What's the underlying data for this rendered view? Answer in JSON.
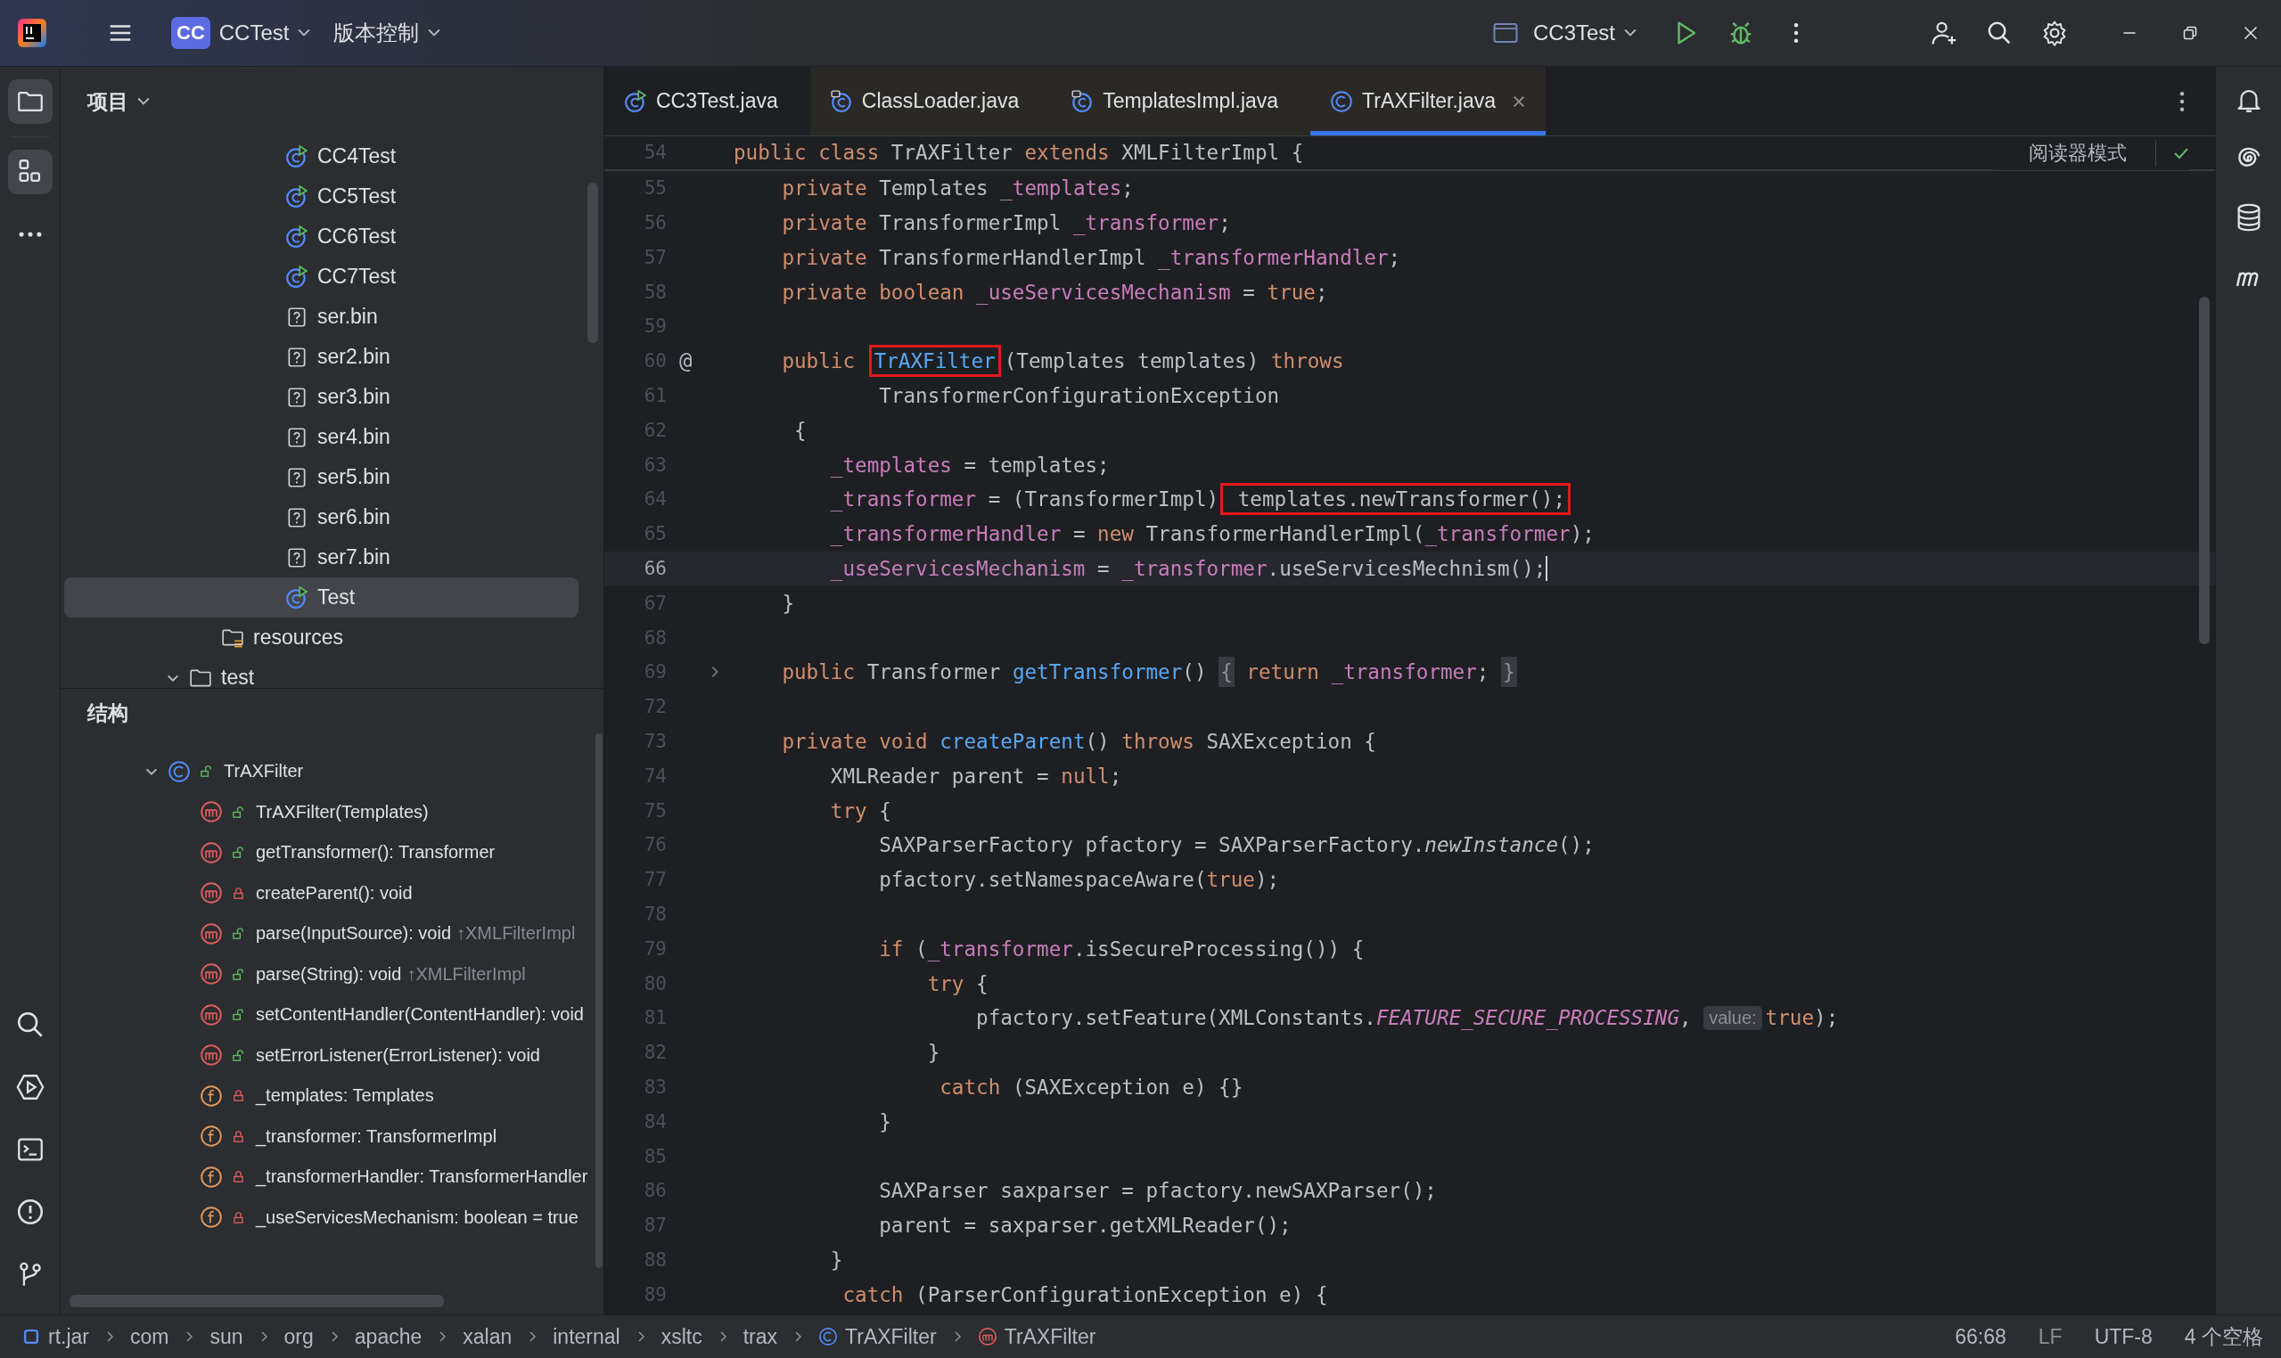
{
  "title_bar": {
    "project_badge": "CC",
    "project_name": "CCTest",
    "vcs": "版本控制",
    "run_config": "CC3Test"
  },
  "project_panel": {
    "title": "项目",
    "tree": [
      {
        "children": [
          {
            "children": [
              {
                "children": [
                  {
                    "label": "CC4Test",
                    "kind": "runnable",
                    "selected": false
                  },
                  {
                    "label": "CC5Test",
                    "kind": "runnable",
                    "selected": false
                  },
                  {
                    "label": "CC6Test",
                    "kind": "runnable",
                    "selected": false
                  },
                  {
                    "label": "CC7Test",
                    "kind": "runnable",
                    "selected": false
                  },
                  {
                    "label": "ser.bin",
                    "kind": "unknown",
                    "selected": false
                  },
                  {
                    "label": "ser2.bin",
                    "kind": "unknown",
                    "selected": false
                  },
                  {
                    "label": "ser3.bin",
                    "kind": "unknown",
                    "selected": false
                  },
                  {
                    "label": "ser4.bin",
                    "kind": "unknown",
                    "selected": false
                  },
                  {
                    "label": "ser5.bin",
                    "kind": "unknown",
                    "selected": false
                  },
                  {
                    "label": "ser6.bin",
                    "kind": "unknown",
                    "selected": false
                  },
                  {
                    "label": "ser7.bin",
                    "kind": "unknown",
                    "selected": false
                  },
                  {
                    "label": "Test",
                    "kind": "runnable",
                    "selected": true
                  }
                ]
              }
            ]
          },
          {
            "label": "resources",
            "kind": "resources",
            "selected": false
          }
        ]
      },
      {
        "label": "test",
        "kind": "folder",
        "expanded": true,
        "selected": false
      }
    ]
  },
  "structure_panel": {
    "title": "结构",
    "tree": [
      {
        "label": "TrAXFilter",
        "kind": "class",
        "locked": false,
        "expanded": true,
        "children": [
          {
            "label": "TrAXFilter(Templates)",
            "kind": "method",
            "locked": false
          },
          {
            "label": "getTransformer(): Transformer",
            "kind": "method",
            "locked": false
          },
          {
            "label": "createParent(): void",
            "kind": "method",
            "locked": true
          },
          {
            "label": "parse(InputSource): void",
            "origin": "↑XMLFilterImpl",
            "kind": "method",
            "locked": false
          },
          {
            "label": "parse(String): void",
            "origin": "↑XMLFilterImpl",
            "kind": "method",
            "locked": false
          },
          {
            "label": "setContentHandler(ContentHandler): void",
            "kind": "method",
            "locked": false
          },
          {
            "label": "setErrorListener(ErrorListener): void",
            "kind": "method",
            "locked": false
          },
          {
            "label": "_templates: Templates",
            "kind": "field",
            "locked": true
          },
          {
            "label": "_transformer: TransformerImpl",
            "kind": "field",
            "locked": true
          },
          {
            "label": "_transformerHandler: TransformerHandler",
            "kind": "field",
            "locked": true
          },
          {
            "label": "_useServicesMechanism: boolean = true",
            "kind": "field",
            "locked": true
          }
        ]
      }
    ]
  },
  "tabs": [
    {
      "label": "CC3Test.java",
      "kind": "runnable",
      "selected": false
    },
    {
      "label": "ClassLoader.java",
      "kind": "library",
      "selected": false
    },
    {
      "label": "TemplatesImpl.java",
      "kind": "library",
      "selected": false
    },
    {
      "label": "TrAXFilter.java",
      "kind": "class",
      "selected": true
    }
  ],
  "editor": {
    "reader_mode": "阅读器模式",
    "lines": [
      {
        "n": "54",
        "sticky": true,
        "code": [
          {
            "t": "public ",
            "kind": "kw"
          },
          {
            "t": "class ",
            "kind": "kw"
          },
          {
            "t": "TrAXFilter "
          },
          {
            "t": "extends ",
            "kind": "kw"
          },
          {
            "t": "XMLFilterImpl {"
          }
        ]
      },
      {
        "n": "55",
        "code": [
          {
            "t": "    private ",
            "kind": "kw"
          },
          {
            "t": "Templates "
          },
          {
            "t": "_templates",
            "kind": "field"
          },
          {
            "t": ";"
          }
        ]
      },
      {
        "n": "56",
        "code": [
          {
            "t": "    private ",
            "kind": "kw"
          },
          {
            "t": "TransformerImpl "
          },
          {
            "t": "_transformer",
            "kind": "field"
          },
          {
            "t": ";"
          }
        ]
      },
      {
        "n": "57",
        "code": [
          {
            "t": "    private ",
            "kind": "kw"
          },
          {
            "t": "TransformerHandlerImpl "
          },
          {
            "t": "_transformerHandler",
            "kind": "field"
          },
          {
            "t": ";"
          }
        ]
      },
      {
        "n": "58",
        "code": [
          {
            "t": "    private ",
            "kind": "kw"
          },
          {
            "t": "boolean ",
            "kind": "kw"
          },
          {
            "t": "_useServicesMechanism",
            "kind": "field"
          },
          {
            "t": " = "
          },
          {
            "t": "true",
            "kind": "kw"
          },
          {
            "t": ";"
          }
        ]
      },
      {
        "n": "59"
      },
      {
        "n": "60",
        "gutter": "@",
        "code": [
          {
            "t": "    public ",
            "kind": "kw"
          },
          {
            "t": "TrAXFilter",
            "kind": "fn",
            "boxed": true
          },
          {
            "t": "(Templates templates) "
          },
          {
            "t": "throws",
            "kind": "kw"
          }
        ]
      },
      {
        "n": "61",
        "code": [
          {
            "t": "            TransformerConfigurationException"
          }
        ]
      },
      {
        "n": "62",
        "code": [
          {
            "t": "     {"
          }
        ]
      },
      {
        "n": "63",
        "code": [
          {
            "t": "        _templates",
            "kind": "field"
          },
          {
            "t": " = templates;"
          }
        ]
      },
      {
        "n": "64",
        "code": [
          {
            "t": "        _transformer",
            "kind": "field"
          },
          {
            "t": " = (TransformerImpl)"
          },
          {
            "t": " templates.newTransformer();",
            "boxed": true
          }
        ]
      },
      {
        "n": "65",
        "code": [
          {
            "t": "        _transformerHandler",
            "kind": "field"
          },
          {
            "t": " = "
          },
          {
            "t": "new ",
            "kind": "kw"
          },
          {
            "t": "TransformerHandlerImpl("
          },
          {
            "t": "_transformer",
            "kind": "field"
          },
          {
            "t": ");"
          }
        ]
      },
      {
        "n": "66",
        "current": true,
        "caret": true,
        "code": [
          {
            "t": "        _useServicesMechanism",
            "kind": "field"
          },
          {
            "t": " = "
          },
          {
            "t": "_transformer",
            "kind": "field"
          },
          {
            "t": ".useServicesMechnism();"
          }
        ]
      },
      {
        "n": "67",
        "code": [
          {
            "t": "    }"
          }
        ]
      },
      {
        "n": "68"
      },
      {
        "n": "69",
        "folded": true,
        "code": [
          {
            "t": "    public ",
            "kind": "kw"
          },
          {
            "t": "Transformer "
          },
          {
            "t": "getTransformer",
            "kind": "fn"
          },
          {
            "t": "() "
          },
          {
            "t": "{",
            "kind": "fold"
          },
          {
            "t": " return ",
            "kind": "kw"
          },
          {
            "t": "_transformer",
            "kind": "field"
          },
          {
            "t": "; "
          },
          {
            "t": "}",
            "kind": "fold"
          }
        ]
      },
      {
        "n": "72"
      },
      {
        "n": "73",
        "code": [
          {
            "t": "    private ",
            "kind": "kw"
          },
          {
            "t": "void ",
            "kind": "kw"
          },
          {
            "t": "createParent",
            "kind": "fn"
          },
          {
            "t": "() "
          },
          {
            "t": "throws ",
            "kind": "kw"
          },
          {
            "t": "SAXException {"
          }
        ]
      },
      {
        "n": "74",
        "code": [
          {
            "t": "        XMLReader parent = "
          },
          {
            "t": "null",
            "kind": "kw"
          },
          {
            "t": ";"
          }
        ]
      },
      {
        "n": "75",
        "code": [
          {
            "t": "        try ",
            "kind": "kw"
          },
          {
            "t": "{"
          }
        ]
      },
      {
        "n": "76",
        "code": [
          {
            "t": "            SAXParserFactory pfactory = SAXParserFactory."
          },
          {
            "t": "newInstance",
            "kind": "italic"
          },
          {
            "t": "();"
          }
        ]
      },
      {
        "n": "77",
        "code": [
          {
            "t": "            pfactory.setNamespaceAware("
          },
          {
            "t": "true",
            "kind": "kw"
          },
          {
            "t": ");"
          }
        ]
      },
      {
        "n": "78"
      },
      {
        "n": "79",
        "code": [
          {
            "t": "            if ",
            "kind": "kw"
          },
          {
            "t": "("
          },
          {
            "t": "_transformer",
            "kind": "field"
          },
          {
            "t": ".isSecureProcessing()) {"
          }
        ]
      },
      {
        "n": "80",
        "code": [
          {
            "t": "                try ",
            "kind": "kw"
          },
          {
            "t": "{"
          }
        ]
      },
      {
        "n": "81",
        "code": [
          {
            "t": "                    pfactory.setFeature(XMLConstants."
          },
          {
            "t": "FEATURE_SECURE_PROCESSING",
            "kind": "static"
          },
          {
            "t": ", "
          },
          {
            "t": "value:",
            "kind": "hint"
          },
          {
            "t": "true",
            "kind": "kw"
          },
          {
            "t": ");"
          }
        ]
      },
      {
        "n": "82",
        "code": [
          {
            "t": "                }"
          }
        ]
      },
      {
        "n": "83",
        "code": [
          {
            "t": "                 catch ",
            "kind": "kw"
          },
          {
            "t": "(SAXException e) {}"
          }
        ]
      },
      {
        "n": "84",
        "code": [
          {
            "t": "            }"
          }
        ]
      },
      {
        "n": "85"
      },
      {
        "n": "86",
        "code": [
          {
            "t": "            SAXParser saxparser = pfactory.newSAXParser();"
          }
        ]
      },
      {
        "n": "87",
        "code": [
          {
            "t": "            parent = saxparser.getXMLReader();"
          }
        ]
      },
      {
        "n": "88",
        "code": [
          {
            "t": "        }"
          }
        ]
      },
      {
        "n": "89",
        "code": [
          {
            "t": "         catch ",
            "kind": "kw"
          },
          {
            "t": "(ParserConfigurationException e) {"
          }
        ]
      }
    ]
  },
  "status_bar": {
    "breadcrumbs": [
      {
        "label": "rt.jar",
        "kind": "jar"
      },
      {
        "label": "com",
        "kind": "package"
      },
      {
        "label": "sun",
        "kind": "package"
      },
      {
        "label": "org",
        "kind": "package"
      },
      {
        "label": "apache",
        "kind": "package"
      },
      {
        "label": "xalan",
        "kind": "package"
      },
      {
        "label": "internal",
        "kind": "package"
      },
      {
        "label": "xsltc",
        "kind": "package"
      },
      {
        "label": "trax",
        "kind": "package"
      },
      {
        "label": "TrAXFilter",
        "kind": "class"
      },
      {
        "label": "TrAXFilter",
        "kind": "method"
      }
    ],
    "position": "66:68",
    "line_separator": "LF",
    "encoding": "UTF-8",
    "indent": "4 个空格"
  }
}
